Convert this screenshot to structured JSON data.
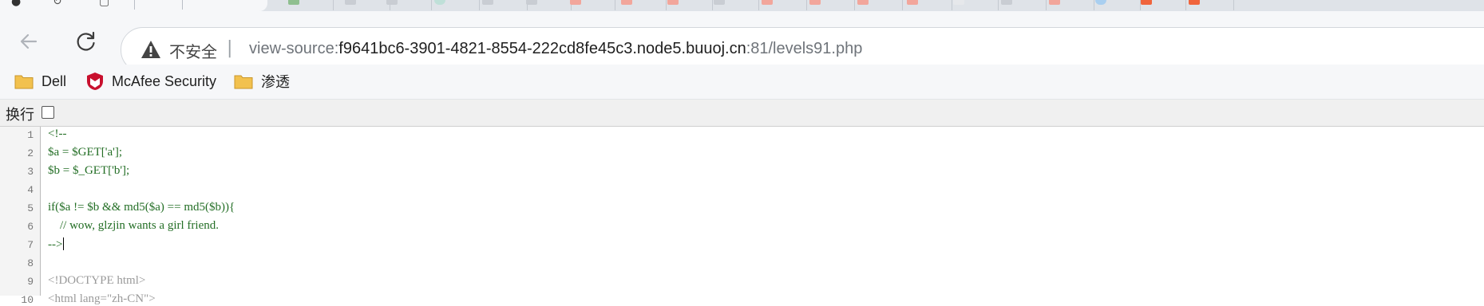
{
  "toolbar": {
    "security_label": "不安全",
    "separator": "|",
    "url_scheme": "view-source:",
    "url_host": "f9641bc6-3901-4821-8554-222cd8fe45c3.node5.buuoj.cn",
    "url_port_path": ":81/levels91.php"
  },
  "bookmarks": [
    {
      "label": "Dell",
      "icon": "folder-icon"
    },
    {
      "label": "McAfee Security",
      "icon": "mcafee-shield-icon"
    },
    {
      "label": "渗透",
      "icon": "folder-icon"
    }
  ],
  "source_view": {
    "wrap_label": "换行",
    "wrap_checked": false,
    "lines": [
      {
        "n": "1",
        "text": "<!--"
      },
      {
        "n": "2",
        "text": "$a = $GET['a'];"
      },
      {
        "n": "3",
        "text": "$b = $_GET['b'];"
      },
      {
        "n": "4",
        "text": ""
      },
      {
        "n": "5",
        "text": "if($a != $b && md5($a) == md5($b)){"
      },
      {
        "n": "6",
        "text": "    // wow, glzjin wants a girl friend."
      },
      {
        "n": "7",
        "text": "-->"
      },
      {
        "n": "8",
        "text": ""
      },
      {
        "n": "9",
        "text": "<!DOCTYPE html>"
      },
      {
        "n": "10",
        "text": "<html lang=\"zh-CN\">"
      }
    ]
  },
  "colors": {
    "comment_green": "#236e25",
    "doctype_gray": "#9a9a9a",
    "warning_gray": "#444444",
    "mcafee_red": "#c8102e",
    "folder_yellow": "#f2c14e"
  }
}
